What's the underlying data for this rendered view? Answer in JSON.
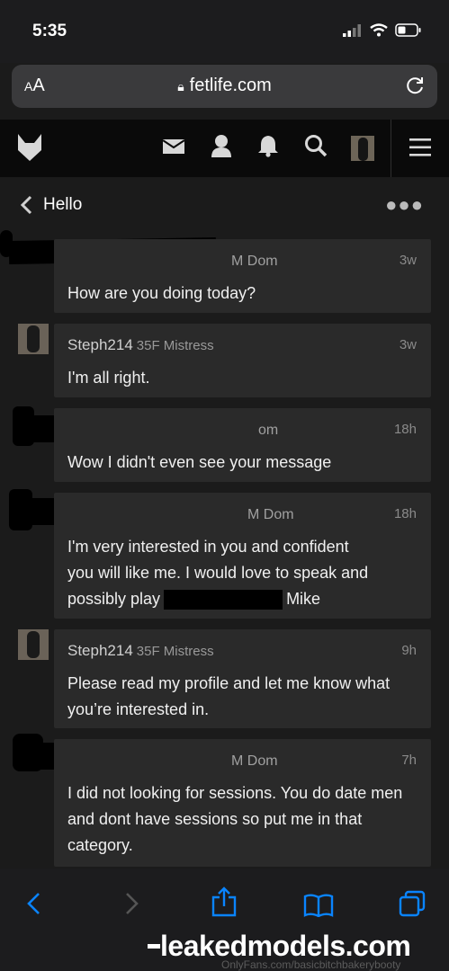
{
  "status": {
    "time": "5:35"
  },
  "address_bar": {
    "aa_small": "A",
    "aa_large": "A",
    "url": "fetlife.com"
  },
  "thread": {
    "title": "Hello"
  },
  "messages": [
    {
      "sender": "",
      "tag": "M Dom",
      "time": "3w",
      "text": "How are you doing today?"
    },
    {
      "sender": "Steph214",
      "tag": "35F Mistress",
      "time": "3w",
      "text": "I'm all right."
    },
    {
      "sender": "",
      "tag": "om",
      "time": "18h",
      "text": "Wow I didn't even see your message"
    },
    {
      "sender": "",
      "tag": "M Dom",
      "time": "18h",
      "text_line1": "I'm very interested in you and confident",
      "text_line2": "you will like me. I would love to speak and",
      "text_line3a": "possibly play",
      "text_line3b": "Mike"
    },
    {
      "sender": "Steph214",
      "tag": "35F Mistress",
      "time": "9h",
      "text": "Please read my profile and let me know what you’re interested in."
    },
    {
      "sender": "",
      "tag": "M Dom",
      "time": "7h",
      "text": "I did not looking for sessions. You do date men and dont have sessions so put me in that category."
    }
  ],
  "watermark": {
    "text": "leakedmodels.com",
    "faded": "OnlyFans.com/basicbitchbakerybooty"
  },
  "colors": {
    "bg": "#1b1b1b",
    "bubble": "#2a2a2a",
    "accent": "#0a84ff"
  }
}
